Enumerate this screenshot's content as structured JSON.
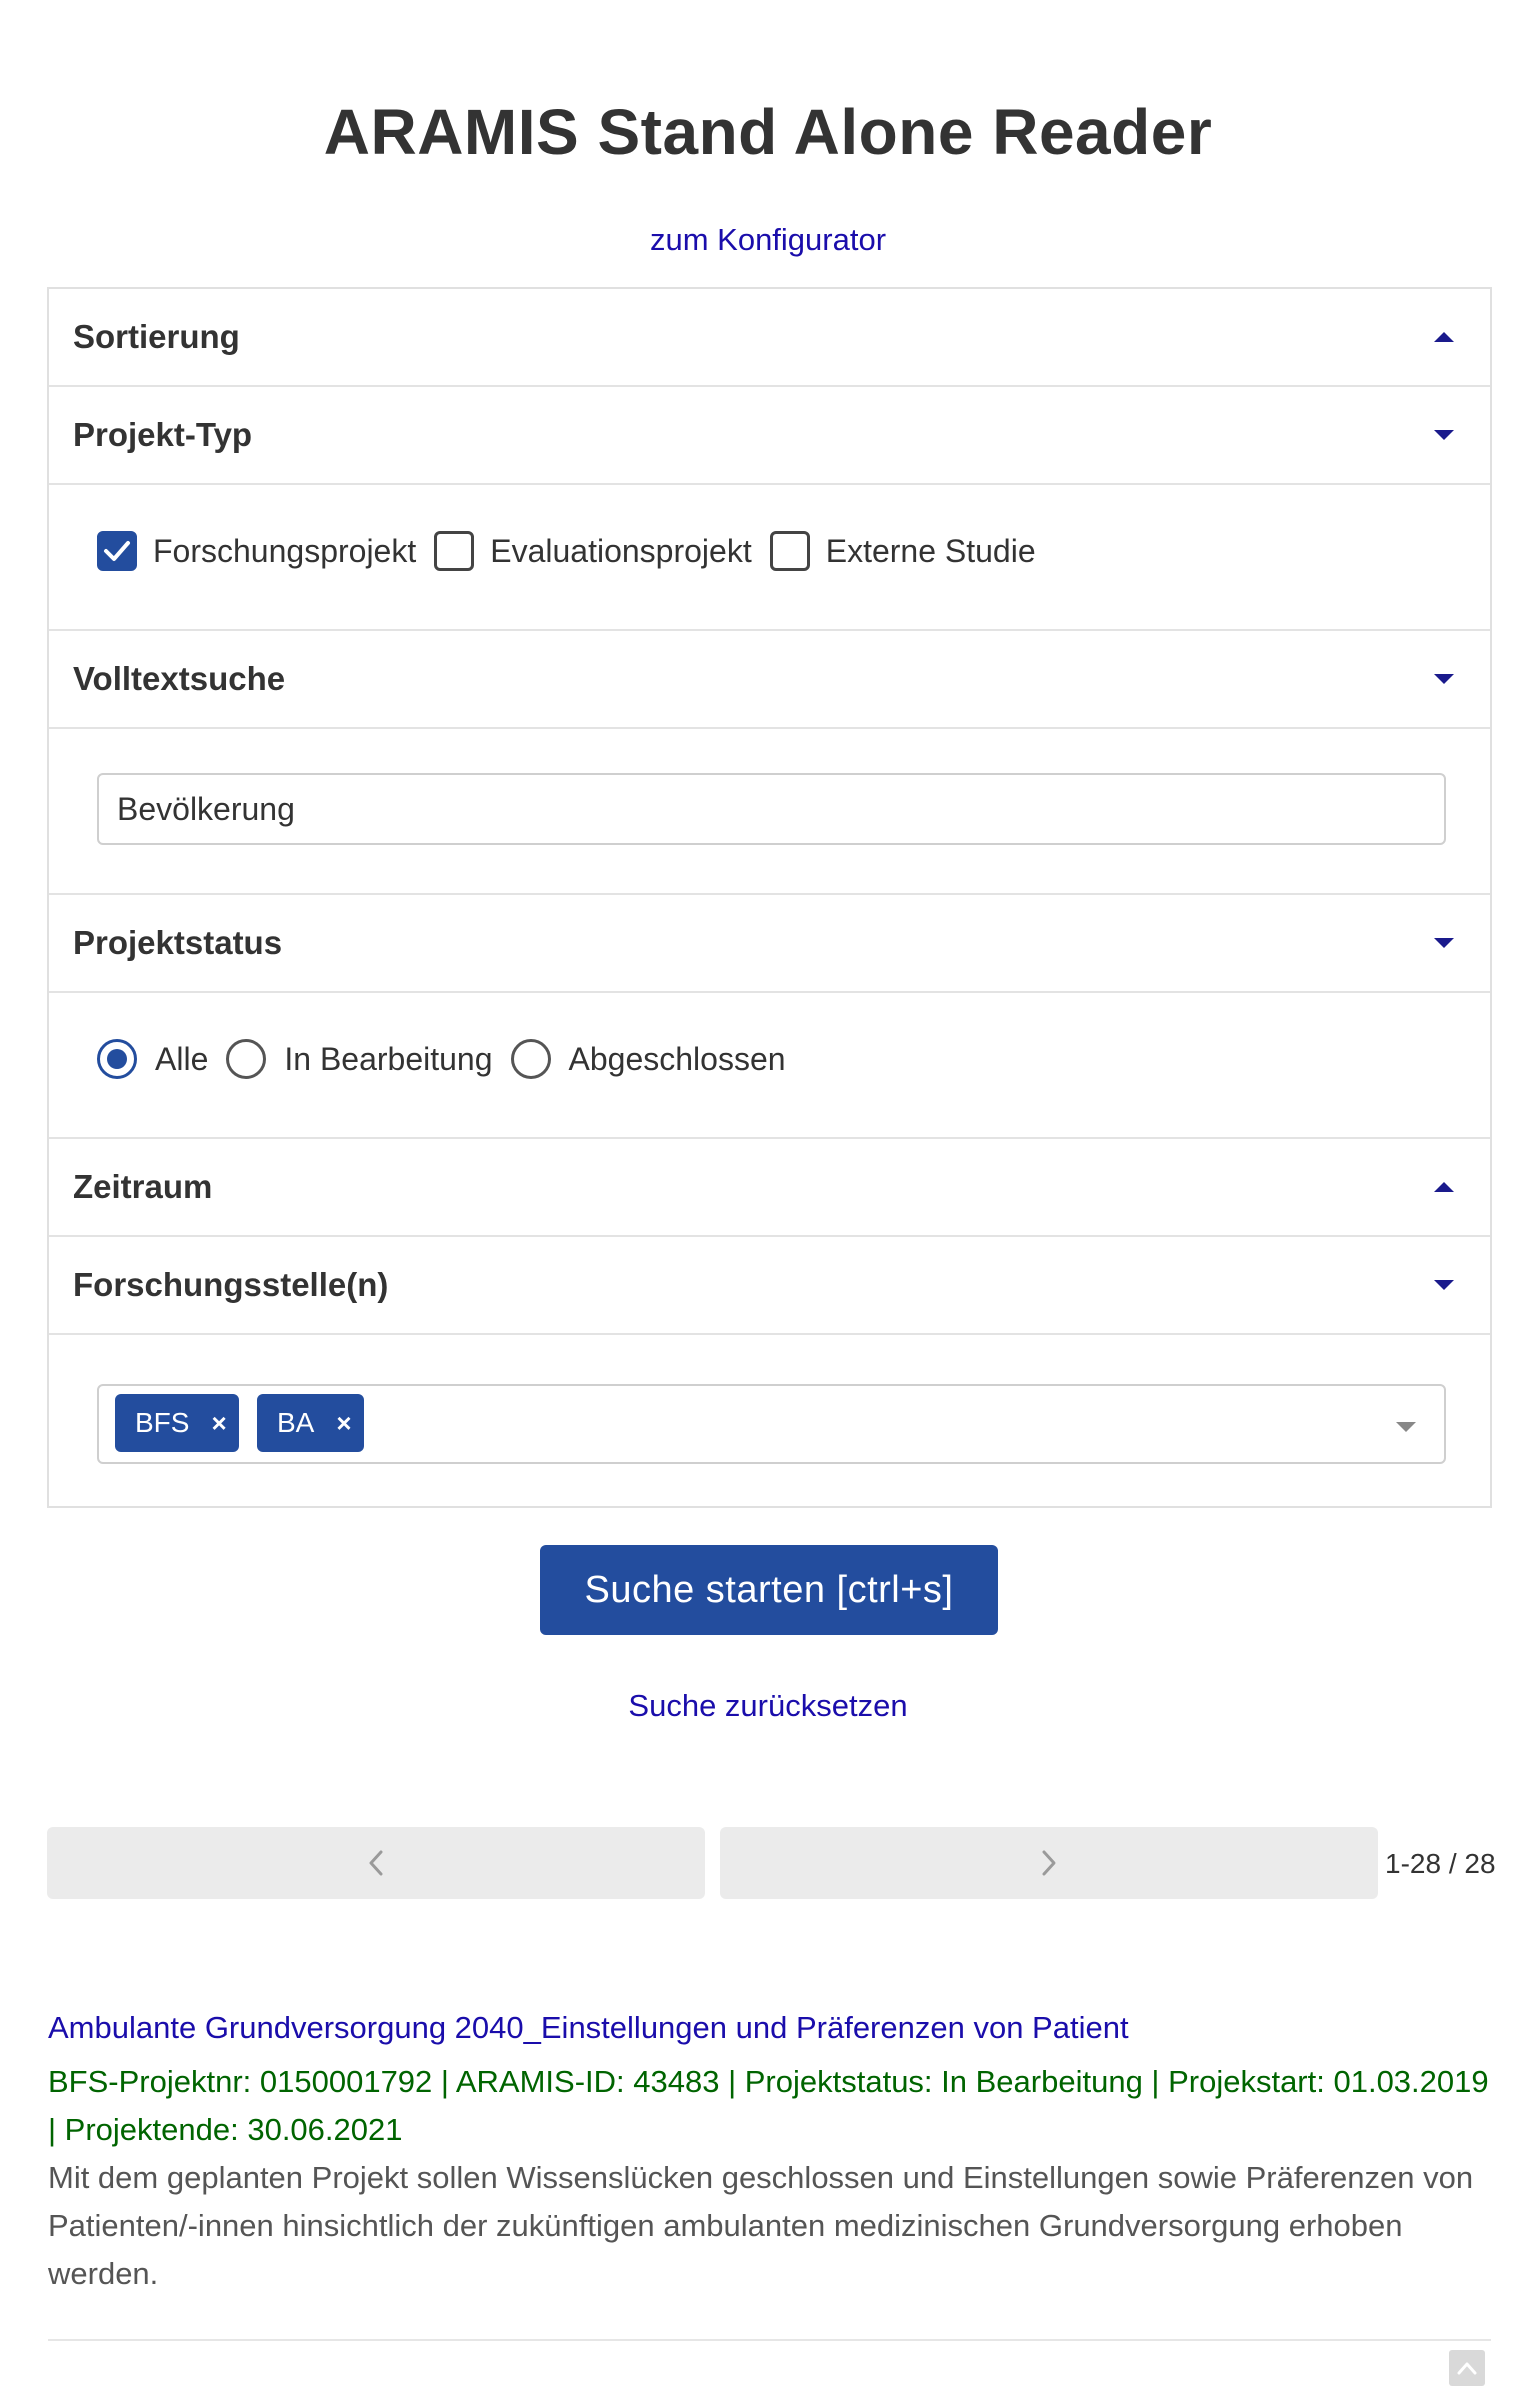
{
  "header": {
    "title": "ARAMIS Stand Alone Reader",
    "config_link": "zum Konfigurator"
  },
  "filters": {
    "sorting": {
      "label": "Sortierung",
      "expanded": false
    },
    "project_type": {
      "label": "Projekt-Typ",
      "expanded": true,
      "options": [
        {
          "label": "Forschungsprojekt",
          "checked": true
        },
        {
          "label": "Evaluationsprojekt",
          "checked": false
        },
        {
          "label": "Externe Studie",
          "checked": false
        }
      ]
    },
    "fulltext": {
      "label": "Volltextsuche",
      "expanded": true,
      "value": "Bevölkerung"
    },
    "status": {
      "label": "Projektstatus",
      "expanded": true,
      "options": [
        {
          "label": "Alle",
          "selected": true
        },
        {
          "label": "In Bearbeitung",
          "selected": false
        },
        {
          "label": "Abgeschlossen",
          "selected": false
        }
      ]
    },
    "period": {
      "label": "Zeitraum",
      "expanded": false
    },
    "research_units": {
      "label": "Forschungsstelle(n)",
      "expanded": true,
      "tags": [
        "BFS",
        "BA"
      ],
      "remove_symbol": "×"
    }
  },
  "actions": {
    "search_label": "Suche starten [ctrl+s]",
    "reset_label": "Suche zurücksetzen"
  },
  "pagination": {
    "range": "1-28 / 28"
  },
  "results": [
    {
      "title": "Ambulante Grundversorgung 2040_Einstellungen und Präferenzen von Patient",
      "meta": "BFS-Projektnr: 0150001792 | ARAMIS-ID: 43483 | Projektstatus: In Bearbeitung | Projekstart: 01.03.2019 | Projektende: 30.06.2021",
      "description": "Mit dem geplanten Projekt sollen Wissenslücken geschlossen und Einstellungen sowie Präferenzen von Patienten/-innen hinsichtlich der zukünftigen ambulanten medizinischen Grundversorgung erhoben werden."
    }
  ],
  "colors": {
    "primary": "#234d9e",
    "link": "#1a0dab",
    "meta_green": "#006400",
    "text": "#333333"
  },
  "icons": {
    "collapse": "triangle-up-icon",
    "expand": "triangle-down-icon",
    "prev": "chevron-left-icon",
    "next": "chevron-right-icon",
    "scroll_top": "chevron-up-icon"
  }
}
